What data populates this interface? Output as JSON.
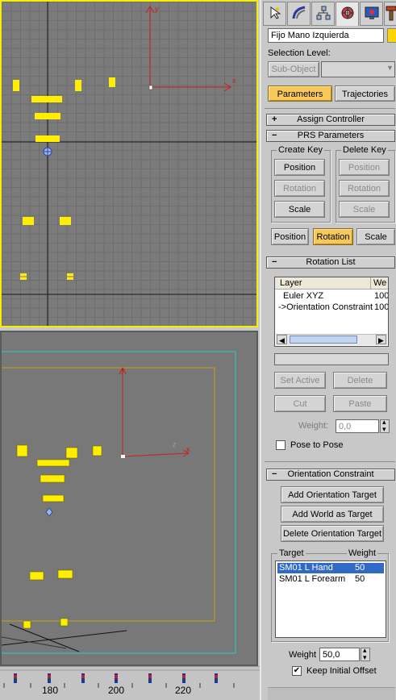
{
  "command_panel": {
    "object_name": "Fijo Mano Izquierda",
    "selection_level_label": "Selection Level:",
    "sub_object_button": "Sub-Object",
    "parameters_button": "Parameters",
    "trajectories_button": "Trajectories",
    "assign_controller": "Assign Controller",
    "prs_parameters": {
      "title": "PRS Parameters",
      "create_key_title": "Create Key",
      "delete_key_title": "Delete Key",
      "create_position": "Position",
      "create_rotation": "Rotation",
      "create_scale": "Scale",
      "delete_position": "Position",
      "delete_rotation": "Rotation",
      "delete_scale": "Scale",
      "mode_position": "Position",
      "mode_rotation": "Rotation",
      "mode_scale": "Scale"
    },
    "rotation_list": {
      "title": "Rotation List",
      "col_layer": "Layer",
      "col_weight": "We",
      "rows": [
        {
          "name": "Euler XYZ",
          "weight": "100"
        },
        {
          "name": "->Orientation Constraint",
          "weight": "100"
        }
      ],
      "set_active": "Set Active",
      "delete": "Delete",
      "cut": "Cut",
      "paste": "Paste",
      "weight_label": "Weight:",
      "weight_value": "0,0",
      "pose_to_pose": "Pose to Pose"
    },
    "orientation_constraint": {
      "title": "Orientation Constraint",
      "add_target": "Add Orientation Target",
      "add_world": "Add World as Target",
      "delete_target": "Delete Orientation Target",
      "col_target": "Target",
      "col_weight": "Weight",
      "targets": [
        {
          "name": "SM01 L Hand",
          "weight": "50"
        },
        {
          "name": "SM01 L Forearm",
          "weight": "50"
        }
      ],
      "weight_label": "Weight",
      "weight_value": "50,0",
      "keep_initial_offset": "Keep Initial Offset"
    }
  },
  "timeline": {
    "ticks": [
      "180",
      "200",
      "220"
    ]
  },
  "viewport_axis_labels": {
    "top_x": "x",
    "top_y": "y",
    "persp_x": "x",
    "persp_y": "y",
    "persp_z": "z"
  },
  "colors": {
    "selection": "#f4f000",
    "active_button": "#f7c85a",
    "list_selection": "#316ac5",
    "axis": "#c82020"
  }
}
